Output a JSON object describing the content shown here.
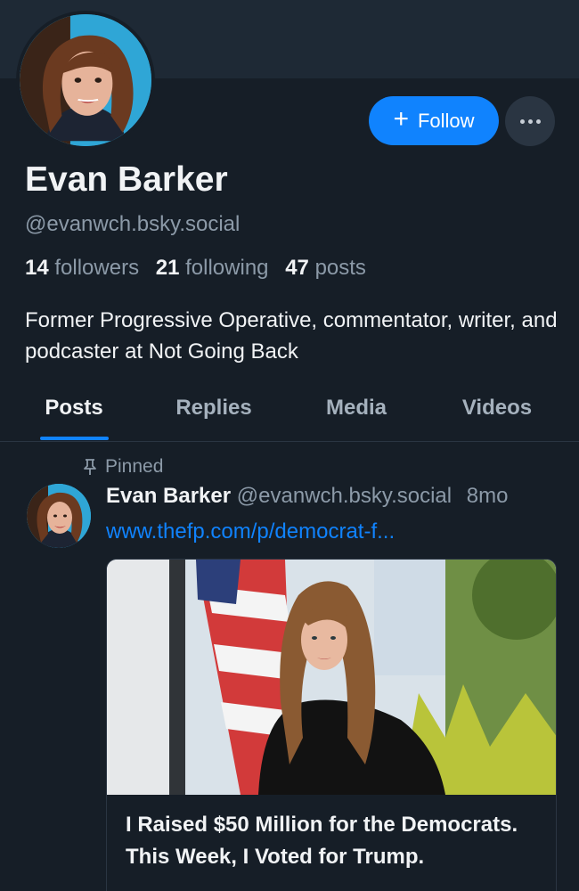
{
  "profile": {
    "display_name": "Evan Barker",
    "handle": "@evanwch.bsky.social",
    "bio": "Former Progressive Operative, commentator, writer, and podcaster at Not Going Back",
    "avatar_icon": "profile-photo",
    "stats": {
      "followers_count": "14",
      "followers_label": "followers",
      "following_count": "21",
      "following_label": "following",
      "posts_count": "47",
      "posts_label": "posts"
    }
  },
  "actions": {
    "follow_label": "Follow",
    "follow_icon": "plus-icon",
    "more_icon": "ellipsis-icon"
  },
  "tabs": [
    {
      "label": "Posts",
      "active": true
    },
    {
      "label": "Replies",
      "active": false
    },
    {
      "label": "Media",
      "active": false
    },
    {
      "label": "Videos",
      "active": false
    }
  ],
  "post": {
    "pinned_label": "Pinned",
    "pinned_icon": "pin-icon",
    "author": "Evan Barker",
    "handle": "@evanwch.bsky.social",
    "time": "8mo",
    "link": "www.thefp.com/p/democrat-f...",
    "embed": {
      "title": "I Raised $50 Million for the Democrats. This Week, I Voted for Trump."
    }
  },
  "colors": {
    "background": "#161e27",
    "accent": "#1083fe",
    "muted_text": "#8c9aa8"
  }
}
